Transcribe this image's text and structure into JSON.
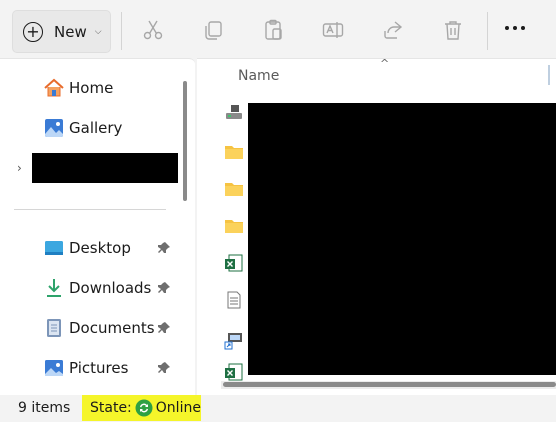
{
  "toolbar": {
    "new_label": "New",
    "actions": [
      {
        "name": "cut",
        "icon": "scissors-icon"
      },
      {
        "name": "copy",
        "icon": "copy-icon"
      },
      {
        "name": "paste",
        "icon": "paste-icon"
      },
      {
        "name": "rename",
        "icon": "rename-icon"
      },
      {
        "name": "share",
        "icon": "share-icon"
      },
      {
        "name": "delete",
        "icon": "trash-icon"
      }
    ],
    "more_icon": "more-icon"
  },
  "nav": {
    "items_top": [
      {
        "label": "Home",
        "icon": "home-icon"
      },
      {
        "label": "Gallery",
        "icon": "gallery-icon"
      }
    ],
    "quick_access": [
      {
        "label": "Desktop",
        "icon": "desktop-folder-icon",
        "pinned": true
      },
      {
        "label": "Downloads",
        "icon": "downloads-folder-icon",
        "pinned": true
      },
      {
        "label": "Documents",
        "icon": "documents-folder-icon",
        "pinned": true
      },
      {
        "label": "Pictures",
        "icon": "pictures-folder-icon",
        "pinned": true
      }
    ]
  },
  "content": {
    "column_name": "Name",
    "file_icons": [
      "drive-icon",
      "folder-icon",
      "folder-icon",
      "folder-icon",
      "excel-icon",
      "text-file-icon",
      "shortcut-icon",
      "excel-icon"
    ]
  },
  "status": {
    "item_count": "9 items",
    "state_label": "State:",
    "state_value": "Online"
  },
  "colors": {
    "highlight": "#f5f52a",
    "accent_blue": "#3a7bd5",
    "folder": "#f6c342",
    "online_green": "#2ea043"
  }
}
